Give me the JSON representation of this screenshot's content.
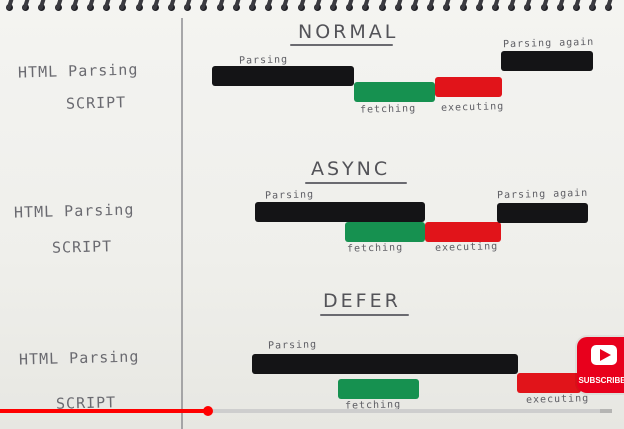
{
  "sections": [
    {
      "title": "NORMAL",
      "left_labels": [
        "HTML Parsing",
        "SCRIPT"
      ],
      "bar_labels": [
        "Parsing",
        "fetching",
        "executing",
        "Parsing again"
      ]
    },
    {
      "title": "ASYNC",
      "left_labels": [
        "HTML Parsing",
        "SCRIPT"
      ],
      "bar_labels": [
        "Parsing",
        "fetching",
        "executing",
        "Parsing again"
      ]
    },
    {
      "title": "DEFER",
      "left_labels": [
        "HTML Parsing",
        "SCRIPT"
      ],
      "bar_labels": [
        "Parsing",
        "fetching",
        "executing"
      ]
    }
  ],
  "youtube": {
    "subscribe_label": "SUBSCRIBE",
    "icon": "play-icon"
  },
  "player": {
    "progress_fraction": 0.34,
    "buffer_fraction": 0.98
  },
  "colors": {
    "parsing": "#141416",
    "fetching": "#169150",
    "executing": "#e1141a",
    "progress": "#ff0000"
  }
}
